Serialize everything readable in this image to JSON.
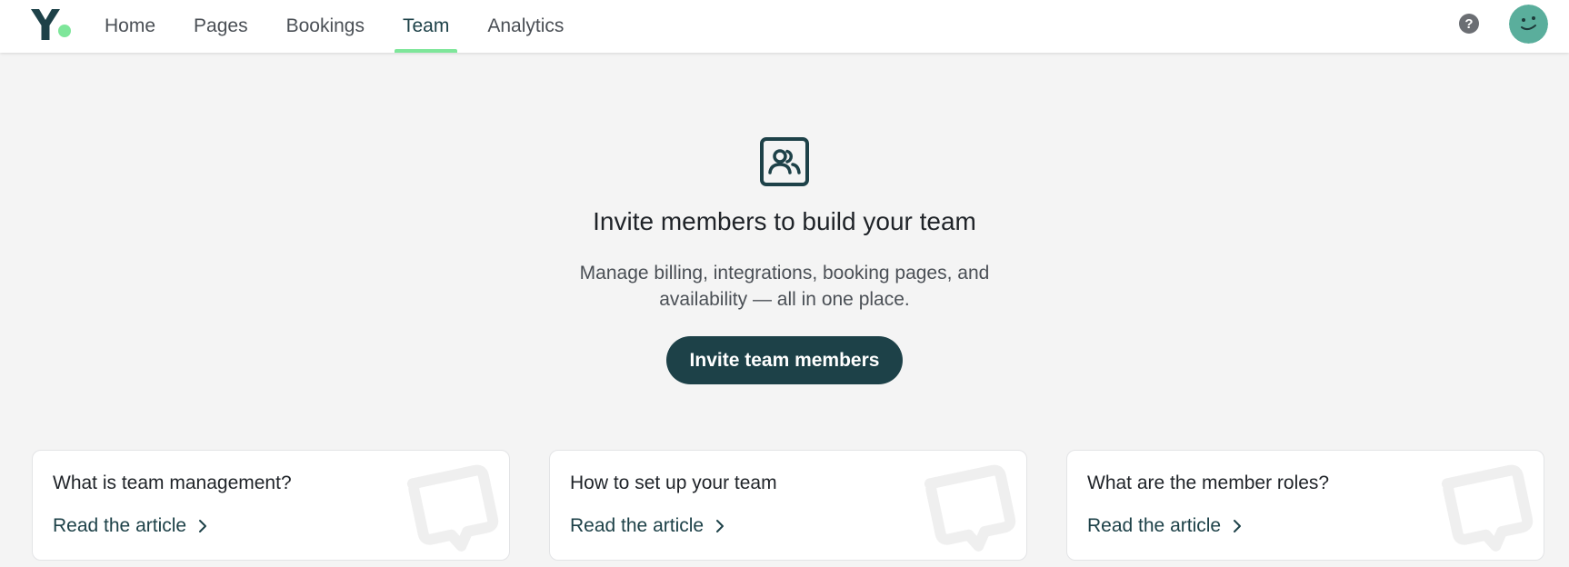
{
  "header": {
    "nav": [
      {
        "label": "Home"
      },
      {
        "label": "Pages"
      },
      {
        "label": "Bookings"
      },
      {
        "label": "Team"
      },
      {
        "label": "Analytics"
      }
    ],
    "active_index": 3,
    "help_glyph": "?",
    "colors": {
      "brand_dark": "#1d4148",
      "brand_accent": "#7ee69a",
      "avatar": "#5aae9c"
    }
  },
  "hero": {
    "icon": "team-icon",
    "title": "Invite members to build your team",
    "description": "Manage billing, integrations, booking pages, and availability — all in one place.",
    "cta_label": "Invite team members"
  },
  "cards": [
    {
      "title": "What is team management?",
      "link": "Read the article"
    },
    {
      "title": "How to set up your team",
      "link": "Read the article"
    },
    {
      "title": "What are the member roles?",
      "link": "Read the article"
    }
  ]
}
